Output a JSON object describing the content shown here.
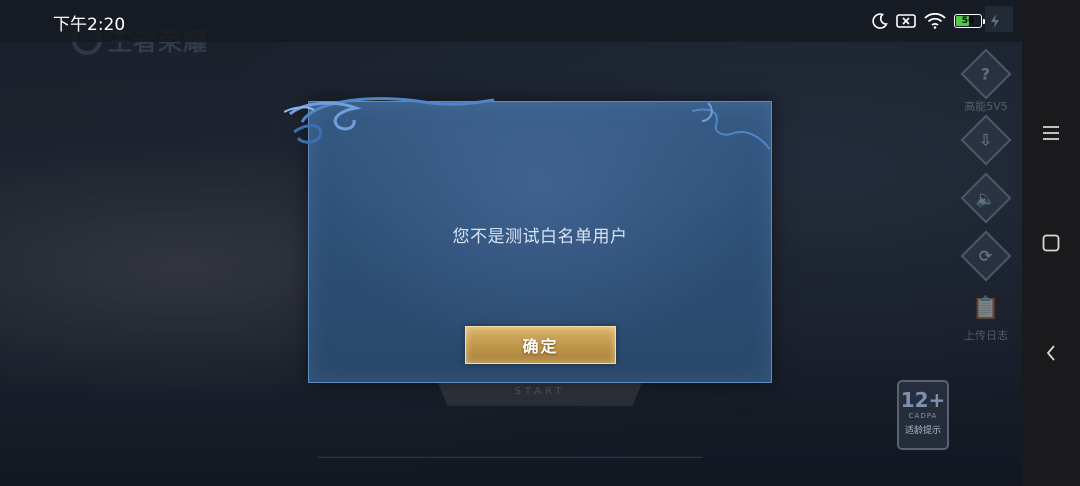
{
  "status_bar": {
    "time": "下午2:20",
    "battery_level": "56",
    "battery_color": "#52c94b",
    "icons": [
      "moon-icon",
      "signal-off-icon",
      "wifi-icon",
      "battery-icon",
      "charging-icon"
    ]
  },
  "dialog": {
    "message": "您不是测试白名单用户",
    "confirm_label": "确定",
    "accent_color": "#d8b36a"
  },
  "background": {
    "logo_text": "王者荣耀",
    "start_label": "START",
    "help_label": "高能5V5",
    "upload_log_label": "上传日志",
    "age_rating": "12+",
    "age_org": "CADPA",
    "age_tip": "适龄提示"
  },
  "nav_bar": {
    "buttons": [
      "menu-icon",
      "home-square-icon",
      "back-chevron-icon"
    ]
  }
}
